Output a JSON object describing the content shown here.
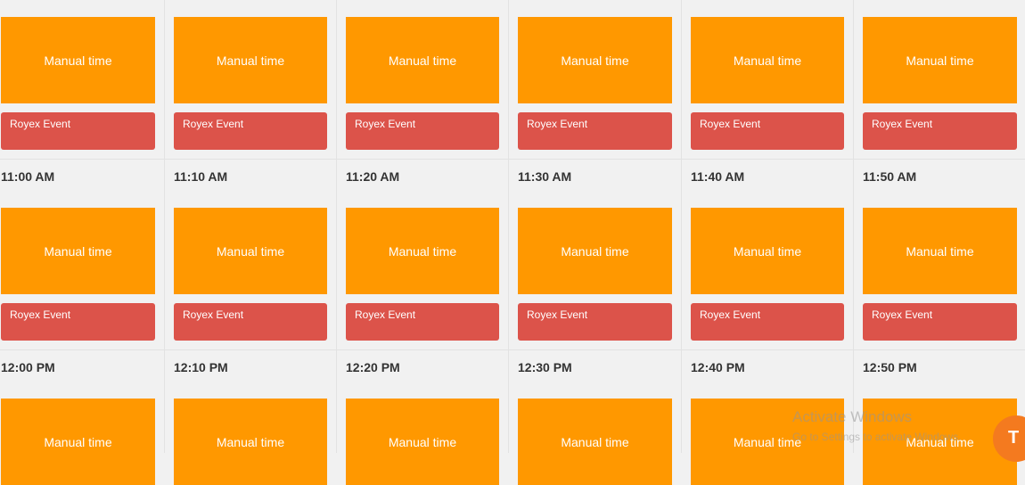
{
  "labels": {
    "manual": "Manual time",
    "event": "Royex Event"
  },
  "rows": [
    {
      "times": []
    },
    {
      "times": [
        "11:00 AM",
        "11:10 AM",
        "11:20 AM",
        "11:30 AM",
        "11:40 AM",
        "11:50 AM"
      ]
    },
    {
      "times": [
        "12:00 PM",
        "12:10 PM",
        "12:20 PM",
        "12:30 PM",
        "12:40 PM",
        "12:50 PM"
      ]
    }
  ],
  "watermark": {
    "title": "Activate Windows",
    "subtitle": "Go to Settings to activate Windows."
  },
  "chat_button": {
    "label": "T"
  },
  "colors": {
    "manual": "#ff9800",
    "event": "#dc534a",
    "background": "#f1f1f1",
    "chat": "#f47a1f"
  }
}
